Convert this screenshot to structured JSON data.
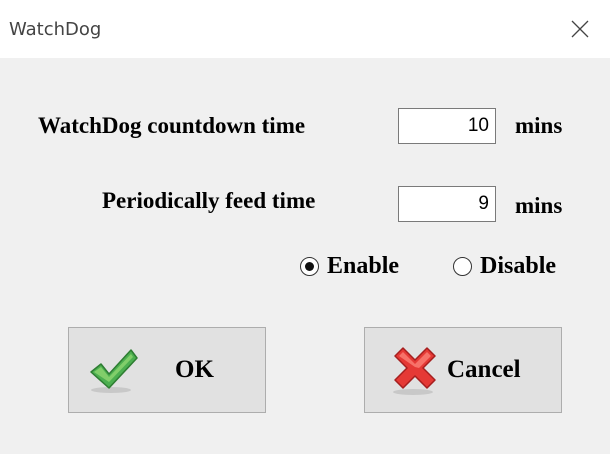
{
  "window": {
    "title": "WatchDog"
  },
  "form": {
    "countdown": {
      "label": "WatchDog countdown time",
      "value": "10",
      "unit": "mins"
    },
    "feed": {
      "label": "Periodically feed time",
      "value": "9",
      "unit": "mins"
    },
    "mode": {
      "enable_label": "Enable",
      "disable_label": "Disable",
      "selected": "Enable"
    }
  },
  "buttons": {
    "ok": {
      "label": "OK",
      "icon": "check-icon"
    },
    "cancel": {
      "label": "Cancel",
      "icon": "x-icon"
    }
  },
  "colors": {
    "check": "#5cb85c",
    "cross": "#d9342b"
  }
}
